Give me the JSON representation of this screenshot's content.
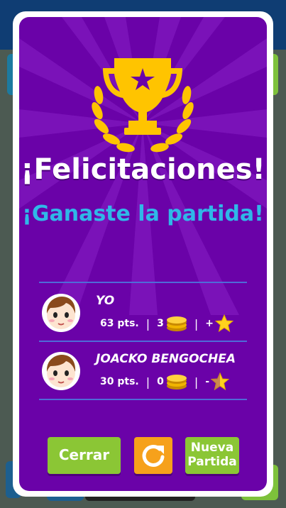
{
  "dialog": {
    "title": "¡Felicitaciones!",
    "subtitle": "¡Ganaste la partida!"
  },
  "players": [
    {
      "name": "YO",
      "points": "63 pts.",
      "coins": "3",
      "stars": "+"
    },
    {
      "name": "JOACKO BENGOCHEA",
      "points": "30 pts.",
      "coins": "0",
      "stars": "-"
    }
  ],
  "buttons": {
    "close": "Cerrar",
    "retry_icon": "refresh-icon",
    "new_game_line1": "Nueva",
    "new_game_line2": "Partida"
  },
  "colors": {
    "dialog_bg": "#6a02a8",
    "subtitle": "#2fb8e8",
    "button_green": "#8bc635",
    "button_orange": "#f6a11b",
    "trophy": "#ffc400"
  }
}
